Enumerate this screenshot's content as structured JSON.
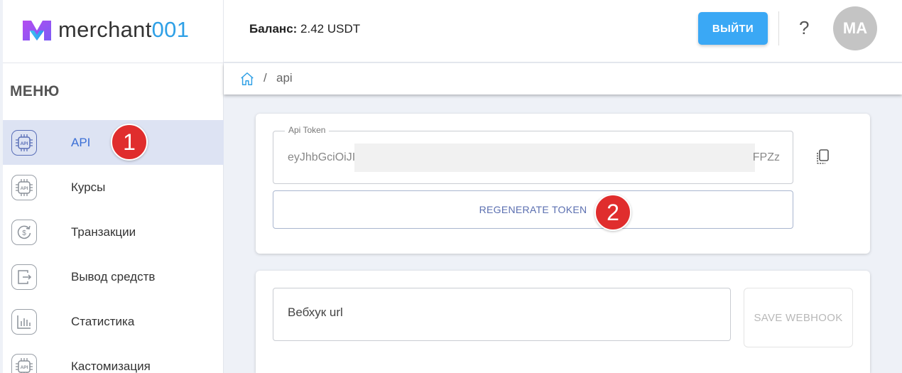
{
  "logo": {
    "prefix": "merchant",
    "suffix": "001"
  },
  "header": {
    "balance_label": "Баланс:",
    "balance_value": "2.42 USDT",
    "logout_label": "ВЫЙТИ",
    "help_icon": "?",
    "avatar_initials": "MA",
    "accent_color": "#3aa8f5"
  },
  "breadcrumb": {
    "separator": "/",
    "current": "api"
  },
  "sidebar": {
    "title": "МЕНЮ",
    "items": [
      {
        "label": "API",
        "icon": "api-chip-icon",
        "active": true
      },
      {
        "label": "Курсы",
        "icon": "api-chip-icon",
        "active": false
      },
      {
        "label": "Транзакции",
        "icon": "dollar-cycle-icon",
        "active": false
      },
      {
        "label": "Вывод средств",
        "icon": "withdraw-icon",
        "active": false
      },
      {
        "label": "Статистика",
        "icon": "bar-chart-icon",
        "active": false
      },
      {
        "label": "Кастомизация",
        "icon": "api-chip-icon",
        "active": false
      }
    ]
  },
  "token_card": {
    "field_label": "Api Token",
    "token_start": "eyJhbGciOiJI",
    "token_end": "FPZz",
    "regenerate_label": "REGENERATE TOKEN"
  },
  "webhook_card": {
    "placeholder": "Вебхук url",
    "save_label": "SAVE WEBHOOK"
  },
  "annotations": {
    "step1": "1",
    "step2": "2"
  }
}
